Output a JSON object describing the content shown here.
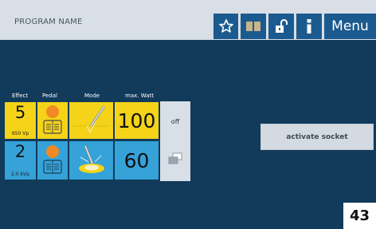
{
  "header": {
    "program_name": "PROGRAM NAME",
    "icons": [
      "star-icon",
      "book-icon",
      "unlock-icon",
      "info-icon"
    ],
    "menu_label": "Menu"
  },
  "columns": {
    "effect": "Effect",
    "pedal": "Pedal",
    "mode": "Mode",
    "max_watt": "max. Watt"
  },
  "channels": [
    {
      "effect": "5",
      "effect_sub": "650 Vp",
      "pedal_icon": "pedal-icon",
      "mode_icon": "cut-mode-icon",
      "max_watt": "100",
      "color": "#f4d318"
    },
    {
      "effect": "2",
      "effect_sub": "2.0 kVp",
      "pedal_icon": "pedal-icon",
      "mode_icon": "coag-mode-icon",
      "max_watt": "60",
      "color": "#35a2d8"
    }
  ],
  "side": {
    "off_label": "off",
    "switch_icon": "window-switch-icon"
  },
  "activate_label": "activate socket",
  "page_number": "43",
  "colors": {
    "background": "#123a5a",
    "header": "#d8dfe6",
    "header_button": "#1b5a8e",
    "yellow": "#f4d318",
    "blue": "#35a2d8"
  }
}
